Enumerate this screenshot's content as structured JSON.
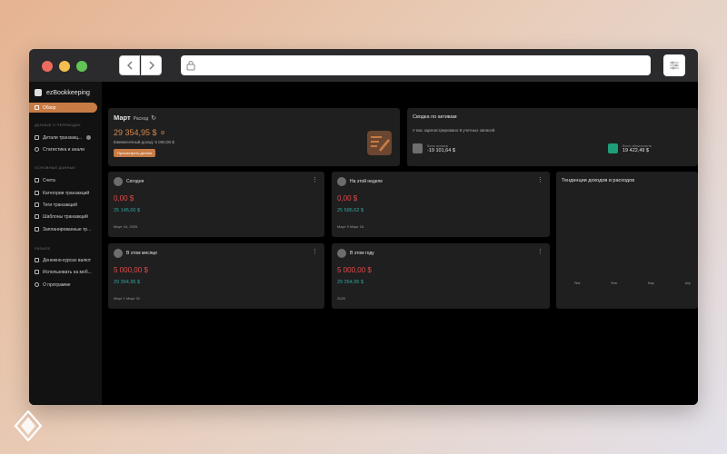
{
  "app": {
    "name": "ezBookkeeping"
  },
  "sidebar": {
    "items_top": [
      {
        "label": "Обзор",
        "icon": "home-icon",
        "active": true
      }
    ],
    "sections": [
      {
        "title": "Данные о переводах",
        "items": [
          {
            "label": "Детали транзакц...",
            "icon": "list-icon"
          },
          {
            "label": "Статистика и анали",
            "icon": "chart-icon"
          }
        ]
      },
      {
        "title": "Основные данные",
        "items": [
          {
            "label": "Счета",
            "icon": "card-icon"
          },
          {
            "label": "Категории транзакций",
            "icon": "grid-icon"
          },
          {
            "label": "Теги транзакций",
            "icon": "tag-icon"
          },
          {
            "label": "Шаблоны транзакций",
            "icon": "template-icon"
          },
          {
            "label": "Запланированные тр...",
            "icon": "calendar-icon"
          }
        ]
      },
      {
        "title": "Разное",
        "items": [
          {
            "label": "Денежно-курсах валют",
            "icon": "exchange-icon"
          },
          {
            "label": "Использовать на моб...",
            "icon": "phone-icon"
          },
          {
            "label": "О программе",
            "icon": "info-icon"
          }
        ]
      }
    ]
  },
  "month_card": {
    "title": "Март",
    "subtitle": "Расход",
    "amount": "29 354,95 $",
    "budget": "Ежемесячный доход: 5 000,00 $",
    "button": "Просмотреть детали"
  },
  "assets_card": {
    "title": "Сводка по активам",
    "desc": "У вас зарегистрировано 8 учетных записей",
    "net_label": "Всего активов",
    "net_value": "-19 101,64 $",
    "liab_label": "Всего обязательств",
    "liab_value": "19 422,49 $"
  },
  "period_cards": [
    {
      "title": "Сегодня",
      "expense": "0,00 $",
      "income": "25 145,00 $",
      "date": "Март 16, 2025"
    },
    {
      "title": "На этой неделе",
      "expense": "0,00 $",
      "income": "25 586,62 $",
      "date": "Март 9 Март 16"
    },
    {
      "title": "В этом месяце",
      "expense": "5 000,00 $",
      "income": "29 354,95 $",
      "date": "Март 1 Март 31"
    },
    {
      "title": "В этом году",
      "expense": "5 000,00 $",
      "income": "29 354,95 $",
      "date": "2025"
    }
  ],
  "trends_card": {
    "title": "Тенденции доходов и расходов",
    "axis_labels": [
      "Янв",
      "Фев",
      "Мар",
      "Апр"
    ]
  },
  "colors": {
    "accent": "#c77b45",
    "expense": "#e44a4a",
    "income": "#32a5a0"
  }
}
